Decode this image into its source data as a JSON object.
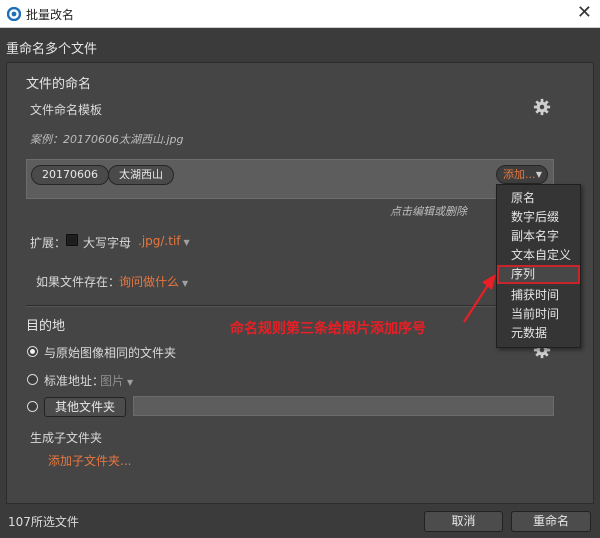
{
  "window": {
    "title": "批量改名"
  },
  "header": {
    "label": "重命名多个文件"
  },
  "naming": {
    "section_title": "文件的命名",
    "template_label": "文件命名模板",
    "example": "案例：20170606太湖西山.jpg",
    "tokens": [
      "20170606",
      "太湖西山"
    ],
    "add_label": "添加...",
    "hint": "点击编辑或删除",
    "extension_label": "扩展：",
    "uppercase_label": "大写字母",
    "extension_value": ".jpg/.tif",
    "exists_label": "如果文件存在：",
    "exists_value": "询问做什么"
  },
  "menu": {
    "items": [
      "原名",
      "数字后缀",
      "副本名字",
      "文本自定义",
      "序列",
      "捕获时间",
      "当前时间",
      "元数据"
    ],
    "highlighted": "序列"
  },
  "destination": {
    "section_title": "目的地",
    "option_same": "与原始图像相同的文件夹",
    "option_standard": "标准地址：",
    "standard_value": "图片",
    "other_folder_button": "其他文件夹",
    "subfolder_label": "生成子文件夹",
    "add_subfolder": "添加子文件夹..."
  },
  "annotation": {
    "text": "命名规则第三条给照片添加序号",
    "color": "#e81f25"
  },
  "footer": {
    "selected_count": "107所选文件",
    "cancel_label": "取消",
    "rename_label": "重命名"
  },
  "colors": {
    "accent": "#e8773f",
    "highlight_border": "#c8242a"
  }
}
